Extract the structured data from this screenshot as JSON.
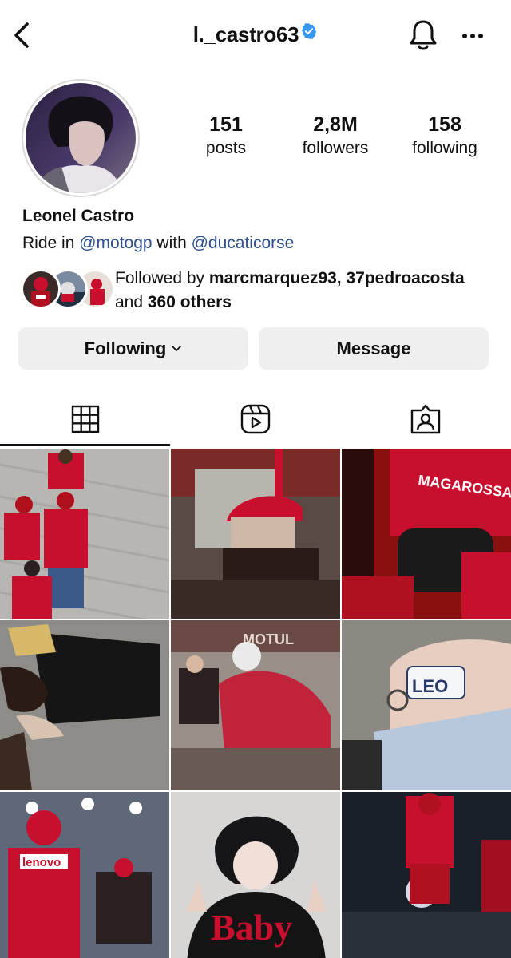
{
  "header": {
    "username": "l._castro63",
    "back_icon": "chevron-left-icon",
    "verified_icon": "verified-badge-icon",
    "bell_icon": "bell-icon",
    "more_icon": "more-horizontal-icon"
  },
  "profile": {
    "full_name": "Leonel Castro",
    "bio_prefix": "Ride in ",
    "bio_mention_1": "@motogp",
    "bio_middle": " with ",
    "bio_mention_2": "@ducaticorse",
    "stats": [
      {
        "value": "151",
        "label": "posts"
      },
      {
        "value": "2,8M",
        "label": "followers"
      },
      {
        "value": "158",
        "label": "following"
      }
    ],
    "followed_by_prefix": "Followed by ",
    "followed_by_names": "marcmarquez93, 37pedroacosta",
    "followed_by_and": "and ",
    "followed_by_others": "360 others"
  },
  "actions": {
    "following_label": "Following",
    "message_label": "Message"
  },
  "tabs": [
    {
      "name": "grid",
      "icon": "grid-icon",
      "active": true
    },
    {
      "name": "reels",
      "icon": "reels-icon",
      "active": false
    },
    {
      "name": "tagged",
      "icon": "tagged-icon",
      "active": false
    }
  ],
  "posts": [
    {
      "caption_text": ""
    },
    {
      "caption_text": ""
    },
    {
      "caption_text": "MAGAROSSA"
    },
    {
      "caption_text": ""
    },
    {
      "caption_text": "MOTUL"
    },
    {
      "caption_text": "LEO"
    },
    {
      "caption_text": "lenovo"
    },
    {
      "caption_text": "Baby"
    },
    {
      "caption_text": ""
    }
  ],
  "colors": {
    "link": "#2b4f8f",
    "verified": "#3897f0",
    "button_bg": "#efefef",
    "ducati_red": "#c8102e"
  }
}
